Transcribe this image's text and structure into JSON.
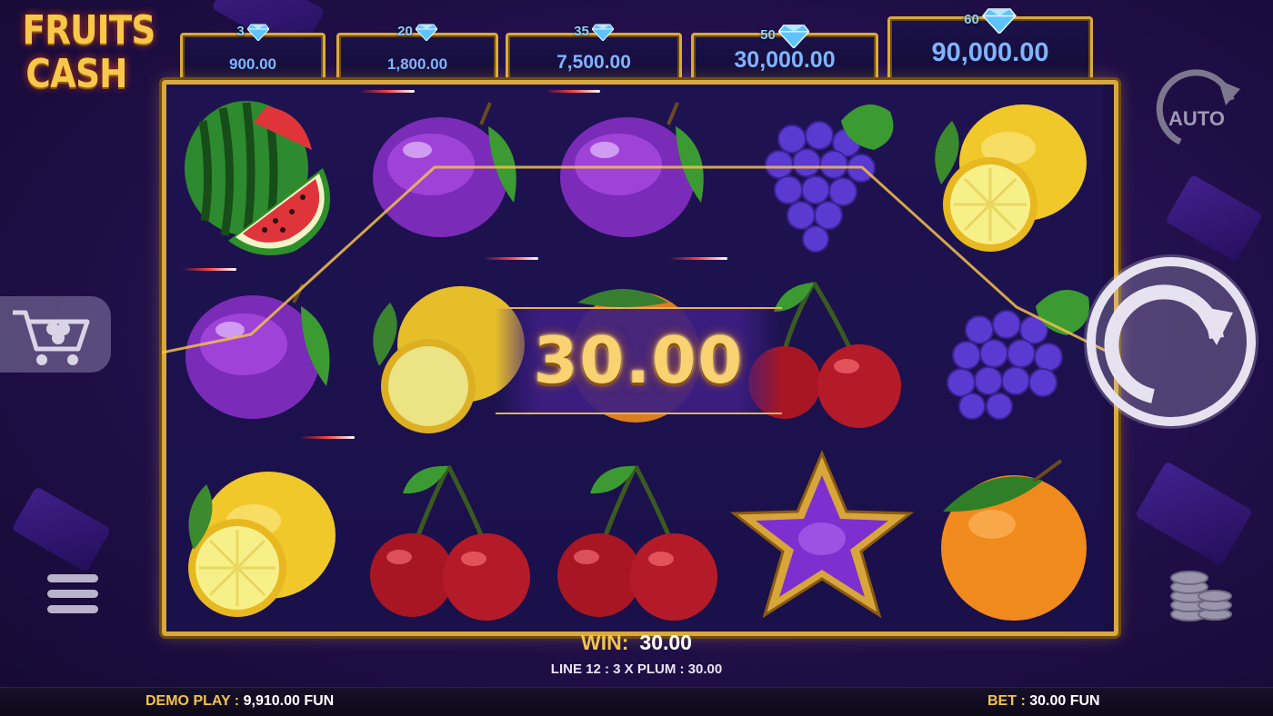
{
  "logo": {
    "line1": "FRUITS",
    "line2": "CASH"
  },
  "jackpots": [
    {
      "count": "3",
      "value": "900.00"
    },
    {
      "count": "20",
      "value": "1,800.00"
    },
    {
      "count": "35",
      "value": "7,500.00"
    },
    {
      "count": "50",
      "value": "30,000.00"
    },
    {
      "count": "60",
      "value": "90,000.00"
    }
  ],
  "reels": [
    [
      "watermelon-symbol",
      "plum-symbol",
      "lemon-symbol"
    ],
    [
      "plum-symbol",
      "lemon-symbol",
      "cherry-symbol"
    ],
    [
      "plum-symbol",
      "orange-symbol",
      "cherry-symbol"
    ],
    [
      "grapes-symbol",
      "cherry-symbol",
      "star-symbol"
    ],
    [
      "lemon-symbol",
      "grapes-symbol",
      "orange-symbol"
    ]
  ],
  "big_win": "30.00",
  "buttons": {
    "auto": "AUTO"
  },
  "win": {
    "label": "WIN:",
    "amount": "30.00",
    "line_info": "LINE 12 : 3 X PLUM : 30.00"
  },
  "bottom": {
    "demo_label": "DEMO PLAY :",
    "demo_balance": "9,910.00 FUN",
    "bet_label": "BET :",
    "bet_value": "30.00 FUN"
  },
  "colors": {
    "gold": "#f2c34a",
    "frame": "#d9a93c",
    "background": "#24104f"
  }
}
